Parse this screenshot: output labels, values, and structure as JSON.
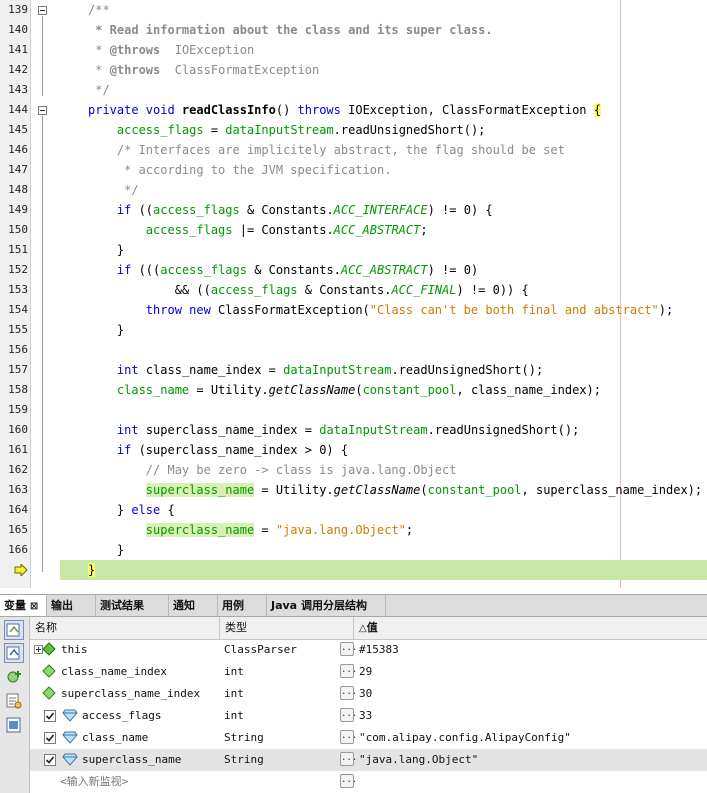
{
  "editor": {
    "lines": [
      {
        "num": "139",
        "html": "<span class=\"cm\">/**</span>"
      },
      {
        "num": "140",
        "html": "<span class=\"cmb\"> * Read information about the class and its super class.</span>"
      },
      {
        "num": "141",
        "html": "<span class=\"cm\"> * </span><span class=\"cmb\">@throws</span><span class=\"cm\">  IOException</span>"
      },
      {
        "num": "142",
        "html": "<span class=\"cm\"> * </span><span class=\"cmb\">@throws</span><span class=\"cm\">  ClassFormatException</span>"
      },
      {
        "num": "143",
        "html": "<span class=\"cm\"> */</span>"
      },
      {
        "num": "144",
        "html": "<span class=\"kw\">private void </span><span class=\"mth\">readClassInfo</span>() <span class=\"kw\">throws</span> IOException, ClassFormatException <span class=\"brace-hl\">{</span>"
      },
      {
        "num": "145",
        "html": "    <span class=\"fld\">access_flags</span> = <span class=\"fld\">dataInputStream</span>.readUnsignedShort();"
      },
      {
        "num": "146",
        "html": "    <span class=\"cm\">/* Interfaces are implicitely abstract, the flag should be set</span>"
      },
      {
        "num": "147",
        "html": "<span class=\"cm\">     * according to the JVM specification.</span>"
      },
      {
        "num": "148",
        "html": "<span class=\"cm\">     */</span>"
      },
      {
        "num": "149",
        "html": "    <span class=\"kw\">if</span> ((<span class=\"fld\">access_flags</span> &amp; Constants.<span class=\"fldi\">ACC_INTERFACE</span>) != 0) {"
      },
      {
        "num": "150",
        "html": "        <span class=\"fld\">access_flags</span> |= Constants.<span class=\"fldi\">ACC_ABSTRACT</span>;"
      },
      {
        "num": "151",
        "html": "    }"
      },
      {
        "num": "152",
        "html": "    <span class=\"kw\">if</span> (((<span class=\"fld\">access_flags</span> &amp; Constants.<span class=\"fldi\">ACC_ABSTRACT</span>) != 0)"
      },
      {
        "num": "153",
        "html": "            &amp;&amp; ((<span class=\"fld\">access_flags</span> &amp; Constants.<span class=\"fldi\">ACC_FINAL</span>) != 0)) {"
      },
      {
        "num": "154",
        "html": "        <span class=\"kw\">throw new </span>ClassFormatException(<span class=\"str\">\"Class can't be both final and abstract\"</span>);"
      },
      {
        "num": "155",
        "html": "    }"
      },
      {
        "num": "156",
        "html": ""
      },
      {
        "num": "157",
        "html": "    <span class=\"kw\">int</span> class_name_index = <span class=\"fld\">dataInputStream</span>.readUnsignedShort();"
      },
      {
        "num": "158",
        "html": "    <span class=\"fld\">class_name</span> = Utility.<span class=\"itl\">getClassName</span>(<span class=\"fld\">constant_pool</span>, class_name_index);"
      },
      {
        "num": "159",
        "html": ""
      },
      {
        "num": "160",
        "html": "    <span class=\"kw\">int</span> superclass_name_index = <span class=\"fld\">dataInputStream</span>.readUnsignedShort();"
      },
      {
        "num": "161",
        "html": "    <span class=\"kw\">if</span> (superclass_name_index &gt; 0) {"
      },
      {
        "num": "162",
        "html": "        <span class=\"cm\">// May be zero -&gt; class is java.lang.Object</span>"
      },
      {
        "num": "163",
        "html": "        <span class=\"fld hl\">superclass_name</span> = Utility.<span class=\"itl\">getClassName</span>(<span class=\"fld\">constant_pool</span>, superclass_name_index);"
      },
      {
        "num": "164",
        "html": "    } <span class=\"kw\">else</span> {"
      },
      {
        "num": "165",
        "html": "        <span class=\"fld hl\">superclass_name</span> = <span class=\"str\">\"java.lang.Object\"</span>;"
      },
      {
        "num": "166",
        "html": "    }"
      },
      {
        "num": "",
        "html": "<span class=\"brace-hl\">}</span>"
      }
    ]
  },
  "panel": {
    "tabs": [
      "变量",
      "输出",
      "测试结果",
      "通知",
      "用例",
      "Java 调用分层结构"
    ],
    "tab_close": "⊠",
    "columns": {
      "name": "名称",
      "type": "类型",
      "value": "值"
    },
    "sort_indicator": "△",
    "variables": [
      {
        "name": "this",
        "type": "ClassParser",
        "value": "#15383",
        "kind": "this"
      },
      {
        "name": "class_name_index",
        "type": "int",
        "value": "29",
        "kind": "local"
      },
      {
        "name": "superclass_name_index",
        "type": "int",
        "value": "30",
        "kind": "local"
      },
      {
        "name": "access_flags",
        "type": "int",
        "value": "33",
        "kind": "watch"
      },
      {
        "name": "class_name",
        "type": "String",
        "value": "\"com.alipay.config.AlipayConfig\"",
        "kind": "watch"
      },
      {
        "name": "superclass_name",
        "type": "String",
        "value": "\"java.lang.Object\"",
        "kind": "watch"
      }
    ],
    "new_watch_placeholder": "<输入新监视>",
    "ellipsis": "..."
  }
}
